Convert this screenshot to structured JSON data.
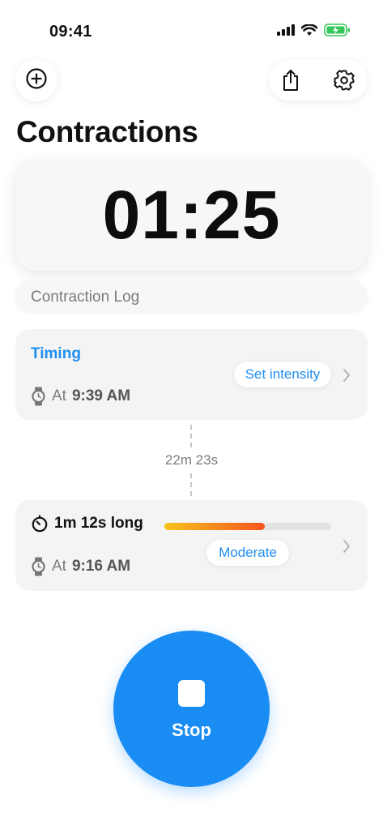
{
  "status_bar": {
    "time": "09:41",
    "icons": [
      "cellular-signal-icon",
      "wifi-icon",
      "battery-charging-icon"
    ]
  },
  "toolbar": {
    "add_icon": "plus-circle-icon",
    "share_icon": "share-icon",
    "settings_icon": "gear-icon"
  },
  "header": {
    "title": "Contractions"
  },
  "timer": {
    "value": "01:25"
  },
  "log": {
    "label": "Contraction Log"
  },
  "entries": [
    {
      "status": "Timing",
      "at_prefix": "At",
      "at_time": "9:39 AM",
      "action_chip": "Set intensity"
    },
    {
      "duration": "1m 12s long",
      "at_prefix": "At",
      "at_time": "9:16 AM",
      "intensity": "Moderate",
      "intensity_level": 0.6
    }
  ],
  "interval": {
    "label": "22m 23s"
  },
  "stop_button": {
    "label": "Stop"
  },
  "colors": {
    "accent": "#1a8df4",
    "link": "#1f8ef1",
    "intensity_start": "#f7c21a",
    "intensity_end": "#f7551f",
    "battery": "#34c759"
  }
}
